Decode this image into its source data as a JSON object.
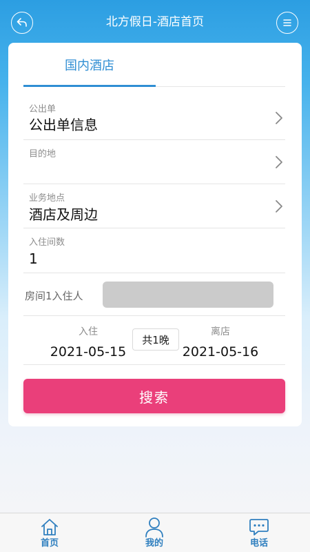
{
  "header": {
    "title": "北方假日-酒店首页",
    "back_icon": "back-icon",
    "menu_icon": "menu-icon"
  },
  "tabs": [
    {
      "label": "国内酒店",
      "active": true
    }
  ],
  "form": {
    "document": {
      "label": "公出单",
      "value": "公出单信息"
    },
    "destination": {
      "label": "目的地",
      "value": ""
    },
    "business_location": {
      "label": "业务地点",
      "value": "酒店及周边"
    },
    "rooms": {
      "label": "入住间数",
      "value": "1"
    },
    "guest": {
      "label": "房间1入住人",
      "value": ""
    },
    "checkin": {
      "label": "入住",
      "date": "2021-05-15"
    },
    "nights": "共1晚",
    "checkout": {
      "label": "离店",
      "date": "2021-05-16"
    },
    "search_label": "搜索"
  },
  "bottom_nav": [
    {
      "label": "首页",
      "icon": "home-icon"
    },
    {
      "label": "我的",
      "icon": "user-icon"
    },
    {
      "label": "电话",
      "icon": "chat-icon"
    }
  ],
  "colors": {
    "accent": "#2f8ed3",
    "search_button": "#ea3f7a",
    "nav_label": "#2f7fbf"
  }
}
